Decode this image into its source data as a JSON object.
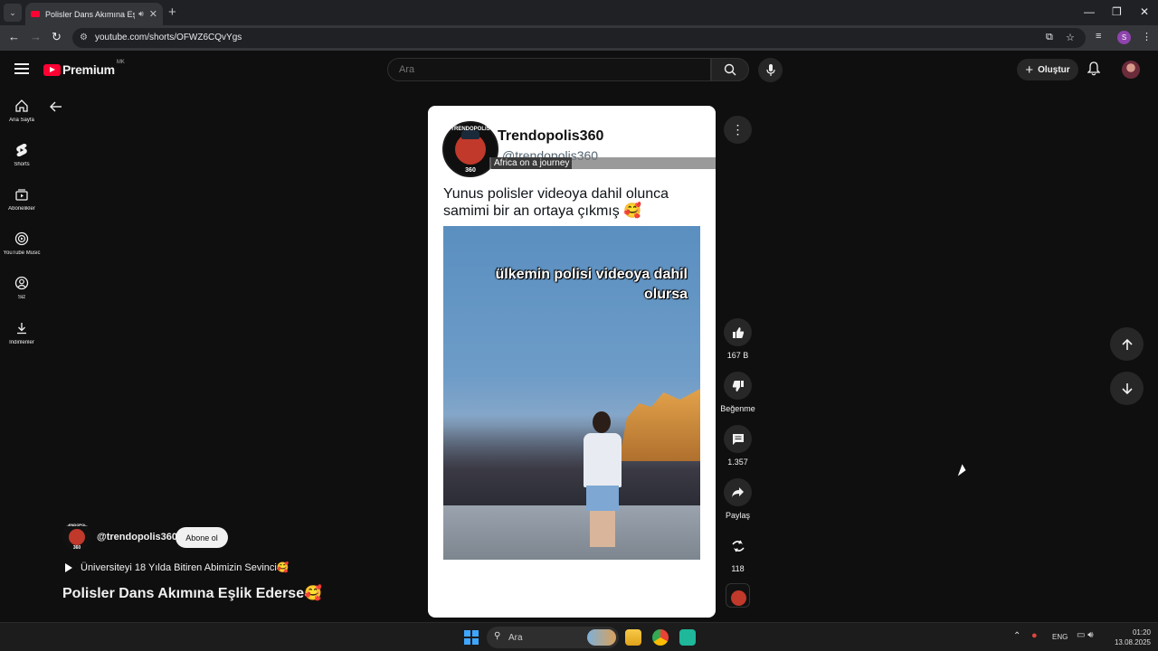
{
  "browser": {
    "tab_title": "Polisler Dans Akımına Eşlik Ederse - YouTube",
    "url": "youtube.com/shorts/OFWZ6CQvYgs",
    "profile_letter": "S"
  },
  "masthead": {
    "logo_text": "Premium",
    "country_code": "MK",
    "search_placeholder": "Ara",
    "create_label": "Oluştur"
  },
  "guide": {
    "items": [
      {
        "label": "Ana Sayfa",
        "icon": "home-icon"
      },
      {
        "label": "Shorts",
        "icon": "shorts-icon"
      },
      {
        "label": "Abonelikler",
        "icon": "subscriptions-icon"
      },
      {
        "label": "YouTube Music",
        "icon": "music-icon"
      },
      {
        "label": "Siz",
        "icon": "you-icon"
      },
      {
        "label": "İndirilenler",
        "icon": "download-icon"
      }
    ]
  },
  "video": {
    "channel_logo_text": "TRENDOPOLIS",
    "channel_logo_number": "360",
    "channel_name": "Trendopolis360",
    "handle": "@trendopolis360",
    "overlay_label": "Africa on a journey",
    "caption": "Yunus polisler videoya dahil olunca samimi bir an ortaya çıkmış 🥰",
    "overlay_text": "ülkemin polisi videoya dahil olursa"
  },
  "actions": {
    "likes": "167 B",
    "dislike_label": "Beğenme",
    "comments": "1.357",
    "share_label": "Paylaş",
    "remix_count": "118"
  },
  "meta": {
    "handle": "@trendopolis360",
    "subscribe_label": "Abone ol",
    "playlist": "Üniversiteyi 18 Yılda Bitiren Abimizin Sevinci🥰",
    "title": "Polisler Dans Akımına Eşlik Ederse🥰"
  },
  "taskbar": {
    "search_label": "Ara",
    "language": "ENG",
    "time": "01:20",
    "date": "13.08.2025"
  },
  "colors": {
    "youtube_red": "#ff0033",
    "background": "#0f0f0f",
    "button_dark": "#272727"
  }
}
